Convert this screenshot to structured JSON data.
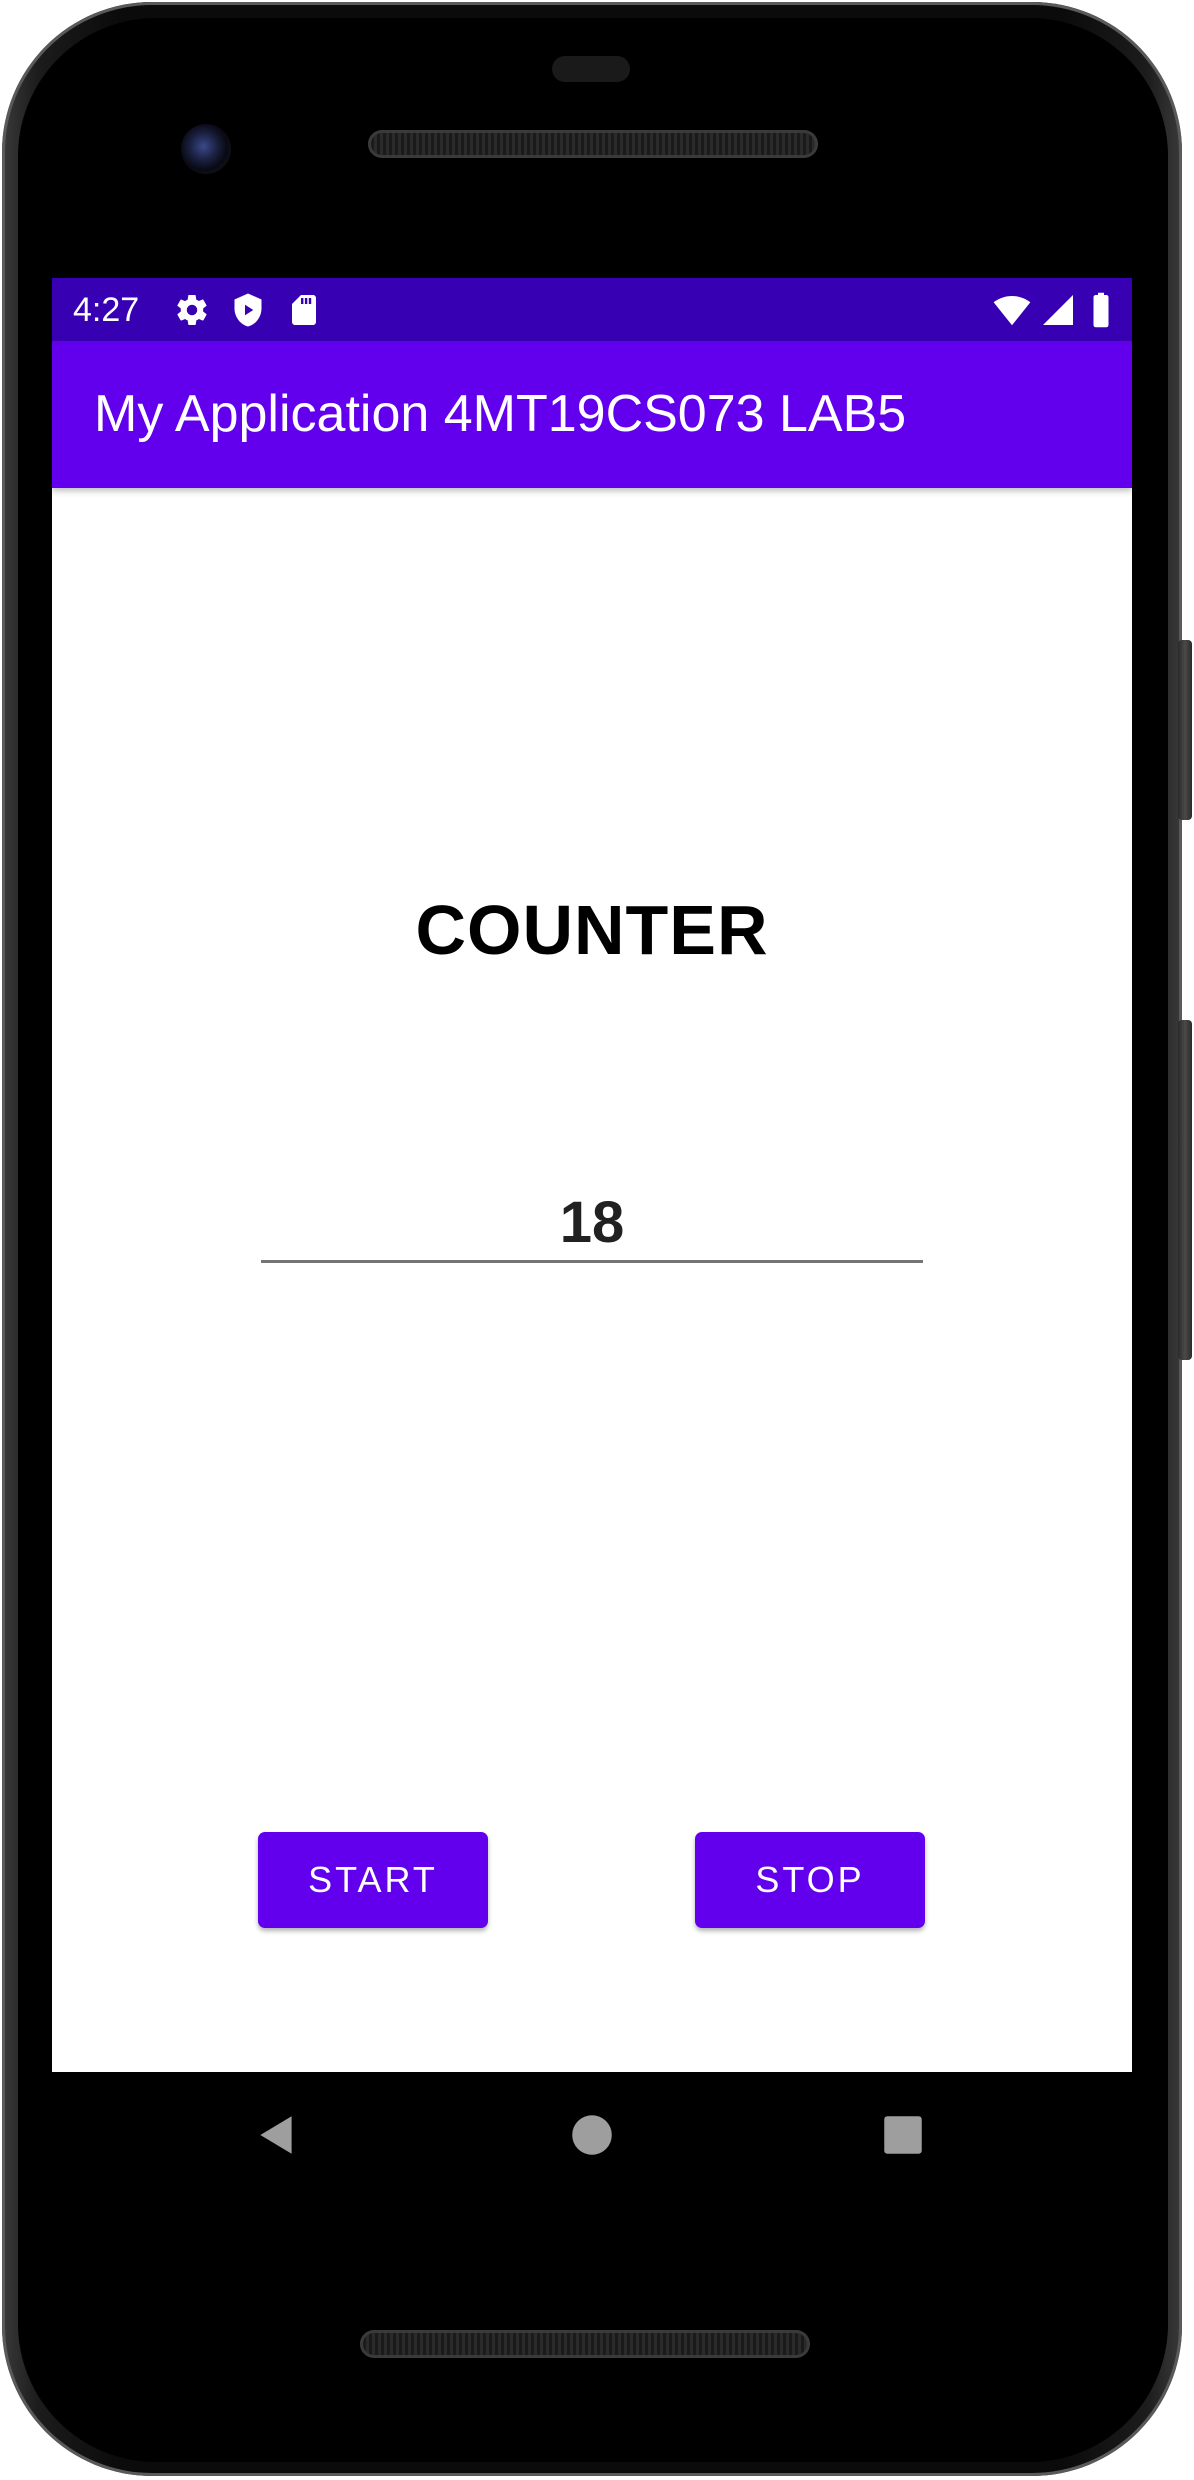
{
  "status_bar": {
    "time": "4:27",
    "left_icons": [
      "settings-gear-icon",
      "play-protect-shield-icon",
      "sd-card-icon"
    ],
    "right_icons": [
      "wifi-icon",
      "cell-signal-icon",
      "battery-icon"
    ],
    "background": "#3700b3"
  },
  "app_bar": {
    "title": "My Application 4MT19CS073 LAB5",
    "background": "#6200ee"
  },
  "main": {
    "heading": "COUNTER",
    "counter_value": "18",
    "start_label": "START",
    "stop_label": "STOP",
    "button_color": "#6200ee"
  },
  "nav_bar": {
    "icons": [
      "back-icon",
      "home-icon",
      "recents-icon"
    ]
  }
}
